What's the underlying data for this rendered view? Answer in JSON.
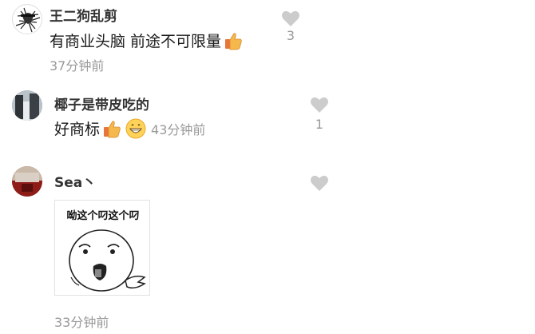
{
  "comments": [
    {
      "username": "王二狗乱剪",
      "text": "有商业头脑 前途不可限量",
      "emoji": [
        "thumbs-up-icon"
      ],
      "time": "37分钟前",
      "likes": "3"
    },
    {
      "username": "椰子是带皮吃的",
      "text": "好商标",
      "emoji": [
        "thumbs-up-icon",
        "grinning-face-icon"
      ],
      "time": "43分钟前",
      "likes": "1"
    },
    {
      "username": "Sea丶",
      "sticker_caption": "呦这个叼这个叼",
      "time": "33分钟前",
      "likes": ""
    }
  ],
  "colors": {
    "username": "#333333",
    "meta": "#999999",
    "heart": "#cccccc"
  }
}
